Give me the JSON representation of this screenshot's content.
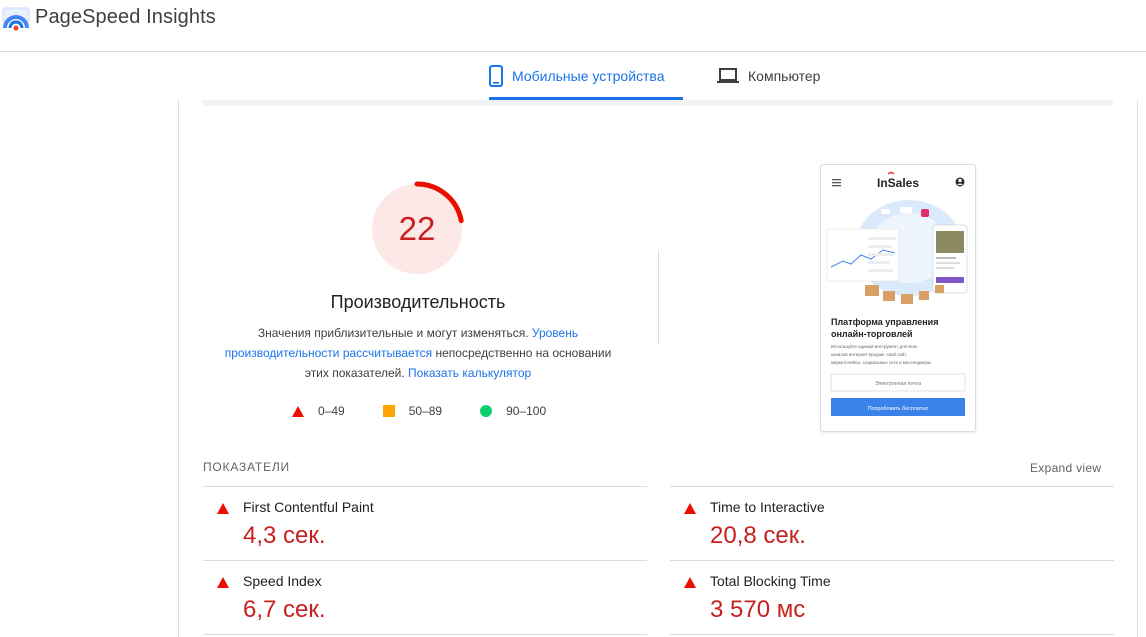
{
  "header": {
    "title": "PageSpeed Insights"
  },
  "tabs": [
    {
      "label": "Мобильные устройства",
      "active": true,
      "icon": "smartphone-icon"
    },
    {
      "label": "Компьютер",
      "active": false,
      "icon": "laptop-icon"
    }
  ],
  "performance": {
    "score": 22,
    "title": "Производительность",
    "desc_text_1": "Значения приблизительные и могут изменяться. ",
    "desc_link_1": "Уровень производительности рассчитывается",
    "desc_text_2": " непосредственно на основании этих показателей. ",
    "desc_link_2": "Показать калькулятор",
    "legend": [
      {
        "label": "0–49",
        "color": "#eb0f00",
        "shape": "triangle"
      },
      {
        "label": "50–89",
        "color": "#ffa400",
        "shape": "square"
      },
      {
        "label": "90–100",
        "color": "#0cce6b",
        "shape": "circle"
      }
    ]
  },
  "screenshot": {
    "brand": "InSales",
    "heading_1": "Платформа управления",
    "heading_2": "онлайн-торговлей",
    "sub_1": "Используйте единый инструмент для всех",
    "sub_2": "каналов интернет-продаж: свой сайт,",
    "sub_3": "маркетплейсы, социальные сети и мессенджеры",
    "email_placeholder": "Электронная почта",
    "cta": "Попробовать бесплатно"
  },
  "metrics_section": {
    "title": "ПОКАЗАТЕЛИ",
    "expand": "Expand view",
    "items": [
      {
        "label": "First Contentful Paint",
        "value": "4,3 сек."
      },
      {
        "label": "Time to Interactive",
        "value": "20,8 сек."
      },
      {
        "label": "Speed Index",
        "value": "6,7 сек."
      },
      {
        "label": "Total Blocking Time",
        "value": "3 570 мс"
      }
    ]
  },
  "colors": {
    "accent": "#1a73e8",
    "fail": "#c5221f",
    "fail_bg": "#fce8e6"
  }
}
